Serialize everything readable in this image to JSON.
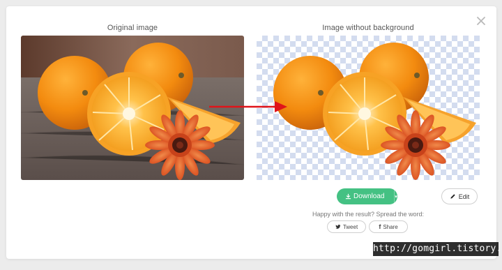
{
  "modal": {
    "left_title": "Original image",
    "right_title": "Image without background",
    "close_icon": "close-icon"
  },
  "actions": {
    "download_label": "Download",
    "download_icon": "download-icon",
    "edit_label": "Edit",
    "edit_icon": "pencil-icon"
  },
  "share": {
    "prompt": "Happy with the result? Spread the word:",
    "tweet_label": "Tweet",
    "share_label": "Share"
  },
  "watermark": {
    "text": "http://gomgirl.tistory.com"
  },
  "colors": {
    "download_green": "#44c183",
    "arrow_red": "#e0141a",
    "checker": "#d3dcef"
  }
}
